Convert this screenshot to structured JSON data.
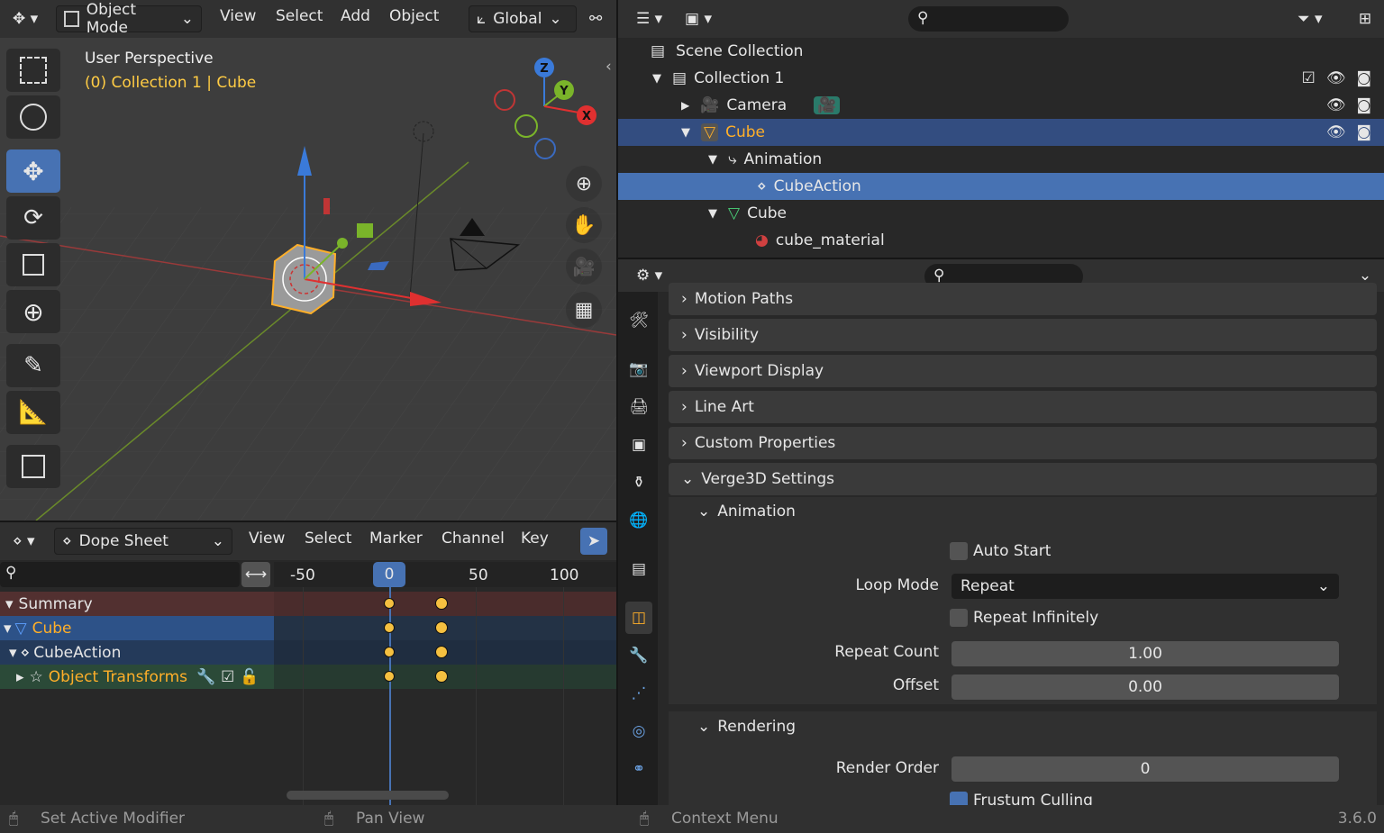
{
  "viewport": {
    "mode_label": "Object Mode",
    "menus": [
      "View",
      "Select",
      "Add",
      "Object"
    ],
    "orientation_label": "Global",
    "overlay_title": "User Perspective",
    "overlay_subtitle": "(0) Collection 1 | Cube",
    "gizmo": {
      "z": "Z",
      "y": "Y",
      "x": "X"
    }
  },
  "dopesheet": {
    "editor_label": "Dope Sheet",
    "menus": [
      "View",
      "Select",
      "Marker",
      "Channel",
      "Key"
    ],
    "ruler": [
      "-50",
      "0",
      "50",
      "100"
    ],
    "channels": [
      {
        "label": "Summary"
      },
      {
        "label": "Cube"
      },
      {
        "label": "CubeAction"
      },
      {
        "label": "Object Transforms"
      }
    ]
  },
  "outliner": {
    "rows": [
      {
        "label": "Scene Collection"
      },
      {
        "label": "Collection 1"
      },
      {
        "label": "Camera"
      },
      {
        "label": "Cube"
      },
      {
        "label": "Animation"
      },
      {
        "label": "CubeAction"
      },
      {
        "label": "Cube"
      },
      {
        "label": "cube_material"
      }
    ]
  },
  "properties": {
    "panels": [
      "Motion Paths",
      "Visibility",
      "Viewport Display",
      "Line Art",
      "Custom Properties",
      "Verge3D Settings"
    ],
    "subpanel_animation": "Animation",
    "auto_start": {
      "label": "Auto Start",
      "checked": false
    },
    "loop_mode": {
      "label": "Loop Mode",
      "value": "Repeat"
    },
    "repeat_infinitely": {
      "label": "Repeat Infinitely",
      "checked": false
    },
    "repeat_count": {
      "label": "Repeat Count",
      "value": "1.00"
    },
    "offset": {
      "label": "Offset",
      "value": "0.00"
    },
    "subpanel_rendering": "Rendering",
    "render_order": {
      "label": "Render Order",
      "value": "0"
    },
    "frustum_culling": {
      "label": "Frustum Culling",
      "checked": true
    }
  },
  "status": {
    "left": "Set Active Modifier",
    "middle": "Pan View",
    "right": "Context Menu",
    "version": "3.6.0"
  },
  "colors": {
    "accent": "#4772b3",
    "active_obj": "#ffaf29",
    "selected_row": "#334d80"
  }
}
